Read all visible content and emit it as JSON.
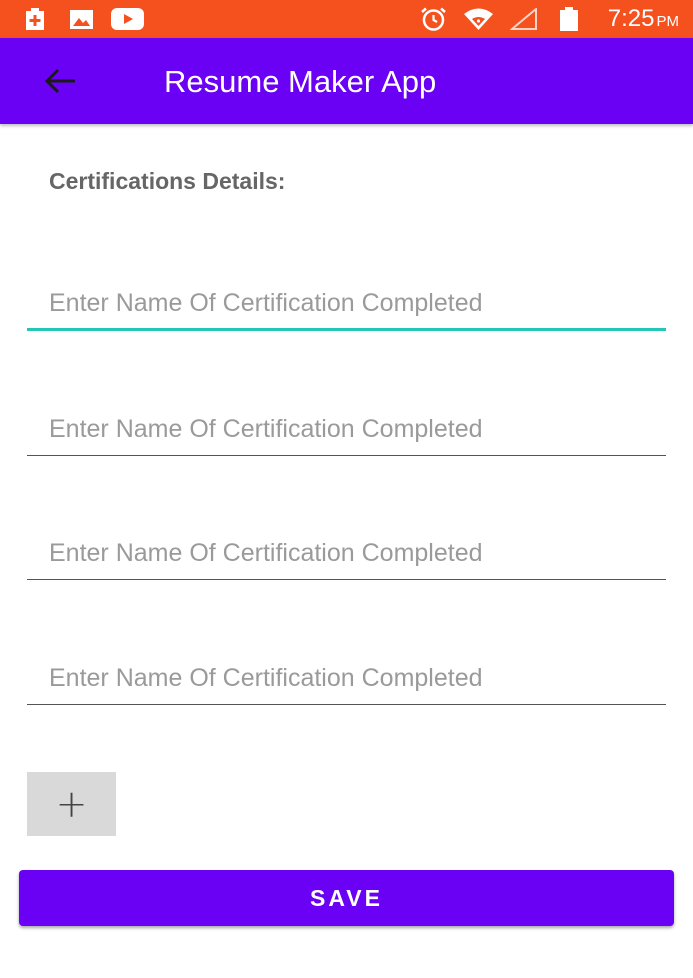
{
  "status_bar": {
    "time": "7:25",
    "period": "PM",
    "icons": [
      "battery-plus-icon",
      "image-icon",
      "youtube-icon",
      "alarm-clock-icon",
      "wifi-icon",
      "signal-icon",
      "battery-icon"
    ],
    "color": "#f4511e"
  },
  "app_bar": {
    "title": "Resume Maker App",
    "back_icon": "arrow-left-icon",
    "color": "#6a00f4"
  },
  "form": {
    "section_title": "Certifications Details:",
    "fields": [
      {
        "placeholder": "Enter Name Of Certification Completed",
        "value": ""
      },
      {
        "placeholder": "Enter Name Of Certification Completed",
        "value": ""
      },
      {
        "placeholder": "Enter Name Of Certification Completed",
        "value": ""
      },
      {
        "placeholder": "Enter Name Of Certification Completed",
        "value": ""
      }
    ],
    "focus_color": "#26c6b4",
    "add_button_label": "+",
    "save_button_label": "SAVE"
  }
}
